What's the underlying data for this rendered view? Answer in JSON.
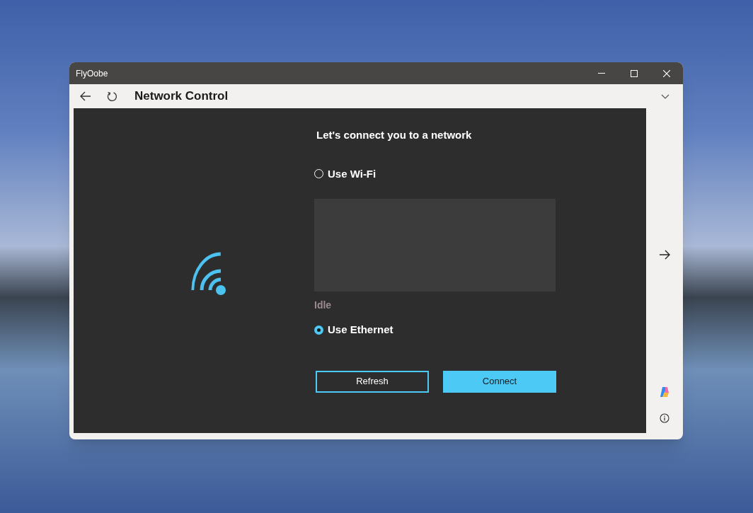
{
  "window": {
    "title": "FlyOobe"
  },
  "toolbar": {
    "title": "Network Control"
  },
  "page": {
    "heading": "Let's connect you to a network",
    "options": [
      {
        "label": "Use Wi-Fi",
        "selected": false
      },
      {
        "label": "Use Ethernet",
        "selected": true
      }
    ],
    "status": "Idle",
    "buttons": [
      {
        "label": "Refresh",
        "kind": "secondary"
      },
      {
        "label": "Connect",
        "kind": "primary"
      }
    ]
  }
}
